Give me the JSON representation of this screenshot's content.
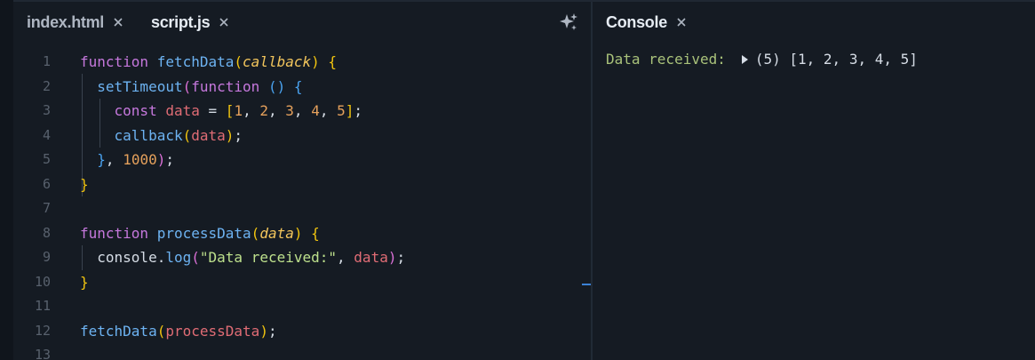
{
  "editor": {
    "tabs": [
      {
        "label": "index.html",
        "active": false
      },
      {
        "label": "script.js",
        "active": true
      }
    ],
    "line_numbers": [
      "1",
      "2",
      "3",
      "4",
      "5",
      "6",
      "7",
      "8",
      "9",
      "10",
      "11",
      "12",
      "13"
    ]
  },
  "console": {
    "tab_label": "Console",
    "output_label": "Data received:",
    "output_value": "(5) [1, 2, 3, 4, 5]"
  },
  "icons": {
    "tab_close": "close-icon",
    "ai": "sparkle-icon",
    "expand": "triangle-right-icon"
  },
  "colors": {
    "background": "#151b23",
    "keyword": "#c678dd",
    "function": "#6db3f2",
    "number": "#e6a15c",
    "string": "#bde08c",
    "variable": "#e06c75"
  }
}
